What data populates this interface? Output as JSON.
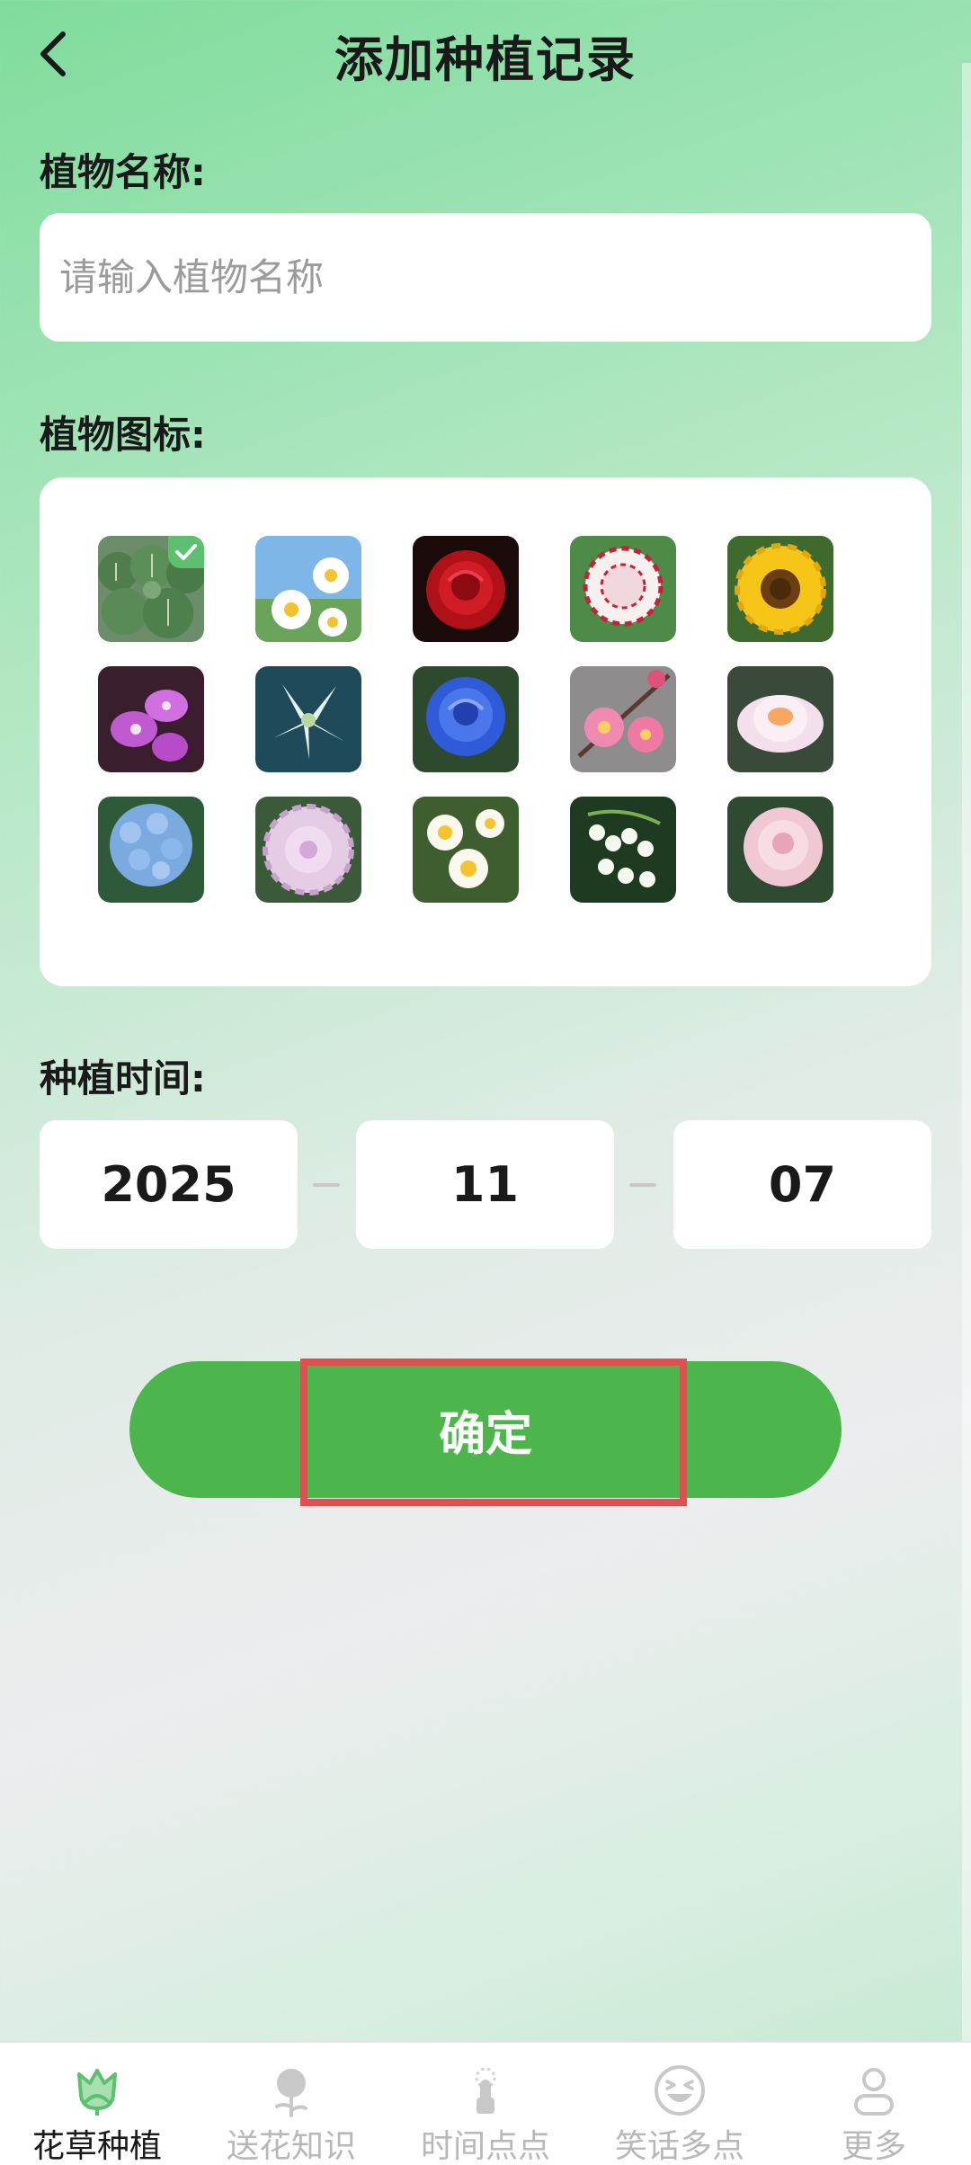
{
  "header": {
    "title": "添加种植记录"
  },
  "form": {
    "name_label": "植物名称:",
    "name_placeholder": "请输入植物名称",
    "icon_label": "植物图标:",
    "time_label": "种植时间:",
    "year": "2025",
    "month": "11",
    "day": "07",
    "confirm_label": "确定"
  },
  "icons": [
    "cactus",
    "daisy",
    "red-rose",
    "carnation",
    "sunflower",
    "orchid",
    "lily",
    "blue-rose",
    "plum-blossom",
    "lotus",
    "hydrangea",
    "peony",
    "frangipani",
    "lily-of-the-valley",
    "camellia"
  ],
  "selected_icon": "cactus",
  "tabs": [
    {
      "label": "花草种植",
      "icon": "flower-bud-icon",
      "active": true
    },
    {
      "label": "送花知识",
      "icon": "rose-icon",
      "active": false
    },
    {
      "label": "时间点点",
      "icon": "touch-icon",
      "active": false
    },
    {
      "label": "笑话多点",
      "icon": "laugh-face-icon",
      "active": false
    },
    {
      "label": "更多",
      "icon": "user-icon",
      "active": false
    }
  ],
  "colors": {
    "accent": "#4cb54c",
    "highlight": "#e05050",
    "tab_active": "#5cc070",
    "tab_inactive": "#b8b8b8"
  }
}
